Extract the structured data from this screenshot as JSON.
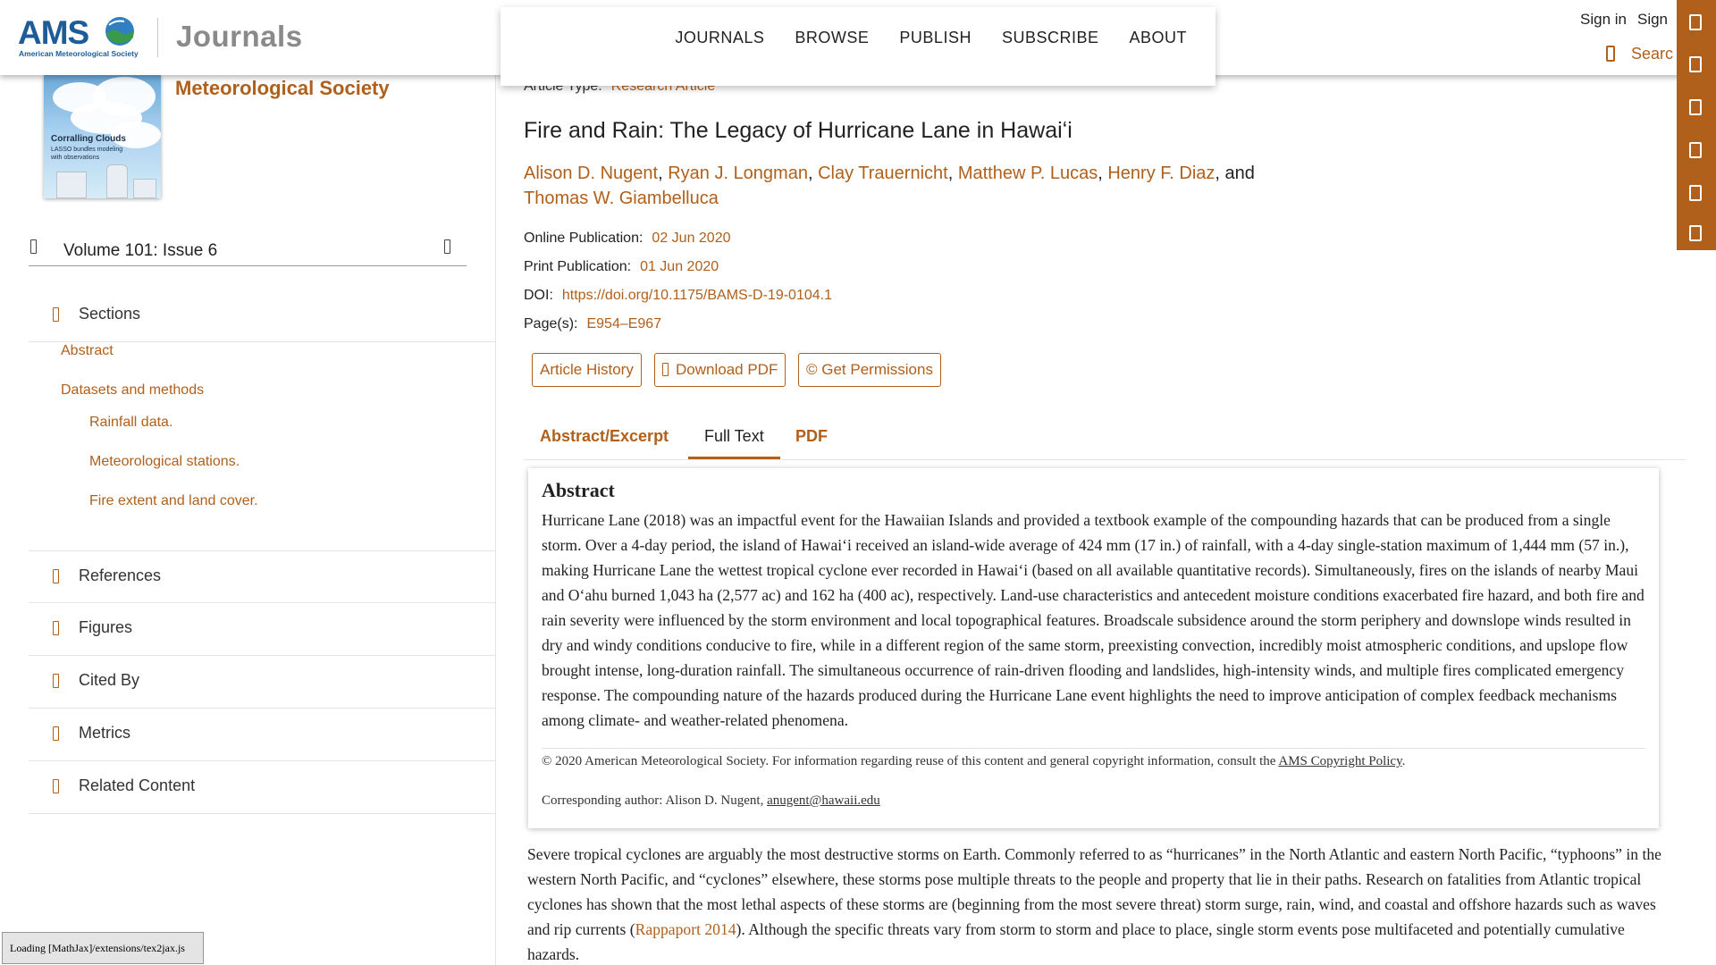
{
  "header": {
    "logo_text": "AMS",
    "logo_tagline": "American Meteorological Society",
    "journals_label": "Journals",
    "nav": [
      "JOURNALS",
      "BROWSE",
      "PUBLISH",
      "SUBSCRIBE",
      "ABOUT"
    ],
    "sign_in": "Sign in",
    "sign_up": "Sign",
    "search_label": "Searc"
  },
  "colors": {
    "accent": "#b0601b",
    "brand_blue": "#1d5c97"
  },
  "side_tools": [
    "tool-icon",
    "tool-icon",
    "tool-icon",
    "tool-icon",
    "tool-icon",
    "tool-icon"
  ],
  "left": {
    "cover_title": "Corralling Clouds",
    "cover_subtitle": "LASSO bundles modeling with observations",
    "society_name": "Meteorological Society",
    "issue": "Volume 101: Issue 6",
    "sections_label": "Sections",
    "toc": [
      {
        "label": "Abstract",
        "level": 1
      },
      {
        "label": "Datasets and methods",
        "level": 1
      },
      {
        "label": "Rainfall data.",
        "level": 2
      },
      {
        "label": "Meteorological stations.",
        "level": 2
      },
      {
        "label": "Fire extent and land cover.",
        "level": 2
      }
    ],
    "accordions": [
      "References",
      "Figures",
      "Cited By",
      "Metrics",
      "Related Content"
    ]
  },
  "article": {
    "type_label": "Article Type:",
    "type_value": "Research Article",
    "title": "Fire and Rain: The Legacy of Hurricane Lane in Hawaiʻi",
    "authors": [
      "Alison D. Nugent",
      "Ryan J. Longman",
      "Clay Trauernicht",
      "Matthew P. Lucas",
      "Henry F. Diaz",
      "Thomas W. Giambelluca"
    ],
    "and_word": ", and",
    "online_label": "Online Publication:",
    "online_value": "02 Jun 2020",
    "print_label": "Print Publication:",
    "print_value": "01 Jun 2020",
    "doi_label": "DOI:",
    "doi_value": "https://doi.org/10.1175/BAMS-D-19-0104.1",
    "pages_label": "Page(s):",
    "pages_value": "E954–E967",
    "buttons": {
      "history": "Article History",
      "pdf": "Download PDF",
      "permissions": "© Get Permissions"
    },
    "tabs": {
      "abstract": "Abstract/Excerpt",
      "full_text": "Full Text",
      "pdf": "PDF"
    },
    "abstract_heading": "Abstract",
    "abstract_text": "Hurricane Lane (2018) was an impactful event for the Hawaiian Islands and provided a textbook example of the compounding hazards that can be produced from a single storm. Over a 4-day period, the island of Hawaiʻi received an island-wide average of 424 mm (17 in.) of rainfall, with a 4-day single-station maximum of 1,444 mm (57 in.), making Hurricane Lane the wettest tropical cyclone ever recorded in Hawaiʻi (based on all available quantitative records). Simultaneously, fires on the islands of nearby Maui and Oʻahu burned 1,043 ha (2,577 ac) and 162 ha (400 ac), respectively. Land-use characteristics and antecedent moisture conditions exacerbated fire hazard, and both fire and rain severity were influenced by the storm environment and local topographical features. Broadscale subsidence around the storm periphery and downslope winds resulted in dry and windy conditions conducive to fire, while in a different region of the same storm, preexisting convection, incredibly moist atmospheric conditions, and upslope flow brought intense, long-duration rainfall. The simultaneous occurrence of rain-driven flooding and landslides, high-intensity winds, and multiple fires complicated emergency response. The compounding nature of the hazards produced during the Hurricane Lane event highlights the need to improve anticipation of complex feedback mechanisms among climate- and weather-related phenomena.",
    "copyright_text": "© 2020 American Meteorological Society. For information regarding reuse of this content and general copyright information, consult the ",
    "copyright_link": "AMS Copyright Policy",
    "copyright_end": ".",
    "corresp_text": "Corresponding author: Alison D. Nugent, ",
    "corresp_email": "anugent@hawaii.edu",
    "intro_before": "Severe tropical cyclones are arguably the most destructive storms on Earth. Commonly referred to as “hurricanes” in the North Atlantic and eastern North Pacific, “typhoons” in the western North Pacific, and “cyclones” elsewhere, these storms pose multiple threats to the people and property that lie in their paths. Research on fatalities from Atlantic tropical cyclones has shown that the most lethal aspects of these storms are (beginning from the most severe threat) storm surge, rain, wind, and coastal and offshore hazards such as waves and rip currents (",
    "intro_link": "Rappaport 2014",
    "intro_after": "). Although the specific threats vary from storm to storm and place to place, single storm events pose multifaceted and potentially cumulative hazards."
  },
  "status": {
    "mathjax": "Loading [MathJax]/extensions/tex2jax.js"
  }
}
